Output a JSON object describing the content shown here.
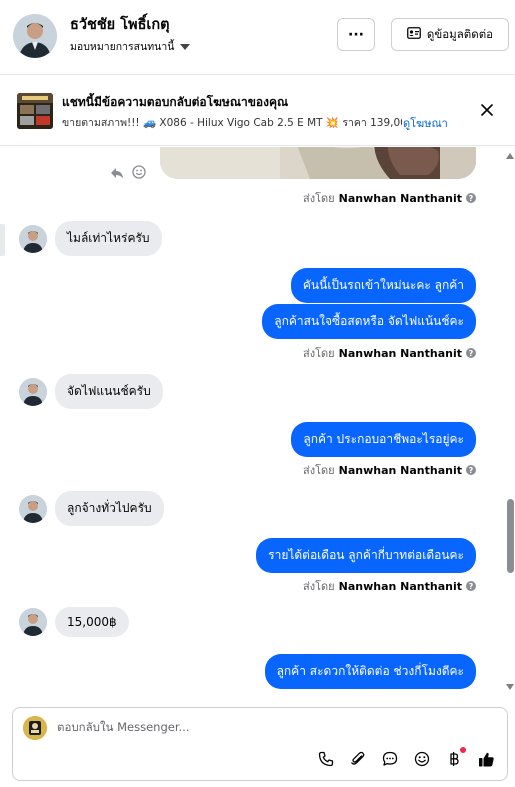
{
  "header": {
    "name": "ธวัชชัย โพธิ์เกตุ",
    "assign_label": "มอบหมายการสนทนานี้",
    "more_label": "···",
    "contact_button": "ดูข้อมูลติดต่อ"
  },
  "ad": {
    "title": "แชทนี้มีข้อความตอบกลับต่อโฆษณาของคุณ",
    "subtitle": "ขายตามสภาพ!!! 🚙 X086 - Hilux Vigo Cab 2.5 E MT 💥 ราคา 139,00...",
    "link": "ดูโฆษณา"
  },
  "messages": [
    {
      "type": "sent-by",
      "prefix": "ส่งโดย",
      "name": "Nanwhan Nanthanit"
    },
    {
      "type": "in",
      "text": "ไมล์เท่าไหร่ครับ"
    },
    {
      "type": "out",
      "text": "คันนี้เป็นรถเข้าใหม่นะคะ  ลูกค้า"
    },
    {
      "type": "out",
      "text": "ลูกค้าสนใจซื้อสดหรือ จัดไฟแน้นช์คะ"
    },
    {
      "type": "sent-by",
      "prefix": "ส่งโดย",
      "name": "Nanwhan Nanthanit"
    },
    {
      "type": "in",
      "text": "จัดไฟแนนช์ครับ"
    },
    {
      "type": "out",
      "text": "ลูกค้า ประกอบอาชีพอะไรอยู่คะ"
    },
    {
      "type": "sent-by",
      "prefix": "ส่งโดย",
      "name": "Nanwhan Nanthanit"
    },
    {
      "type": "in",
      "text": "ลูกจ้างทั่วไปครับ"
    },
    {
      "type": "out",
      "text": "รายได้ต่อเดือน  ลูกค้ากี่บาทต่อเดือนคะ"
    },
    {
      "type": "sent-by",
      "prefix": "ส่งโดย",
      "name": "Nanwhan Nanthanit"
    },
    {
      "type": "in",
      "text": "15,000฿"
    },
    {
      "type": "out",
      "text": "ลูกค้า สะดวกให้ติดต่อ ช่วงกี่โมงดีคะ"
    }
  ],
  "composer": {
    "placeholder": "ตอบกลับใน Messenger..."
  },
  "icons": {
    "reply": "reply-icon",
    "react": "smiley-icon",
    "call": "phone-icon",
    "attach": "paperclip-icon",
    "saved_reply": "chat-bubble-icon",
    "emoji": "emoji-icon",
    "payment": "baht-icon",
    "like": "thumbs-up-icon"
  },
  "colors": {
    "outgoing_bubble": "#0866ff",
    "incoming_bubble": "#e9ebee",
    "link": "#0064d1",
    "notification_dot": "#f02849"
  }
}
